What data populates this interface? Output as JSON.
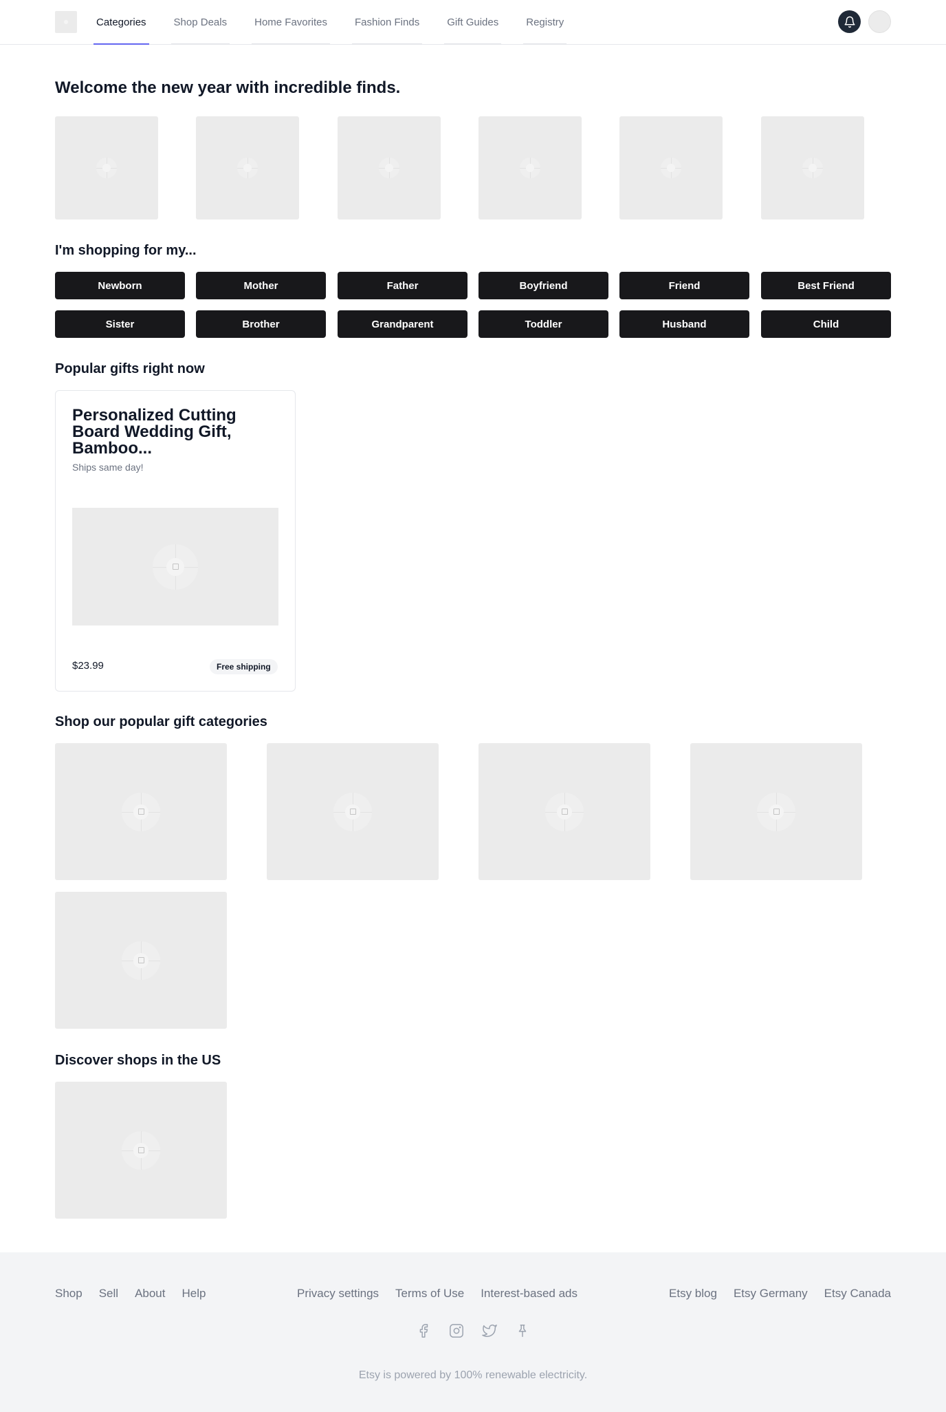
{
  "nav": {
    "tabs": [
      {
        "label": "Categories"
      },
      {
        "label": "Shop Deals"
      },
      {
        "label": "Home Favorites"
      },
      {
        "label": "Fashion Finds"
      },
      {
        "label": "Gift Guides"
      },
      {
        "label": "Registry"
      }
    ],
    "active_tab": "Categories",
    "accent_color": "#6366f1"
  },
  "icons": {
    "notifications": "bell-icon",
    "profile": "avatar"
  },
  "hero": {
    "title": "Welcome the new year with incredible finds."
  },
  "shopping_for": {
    "title": "I'm shopping for my...",
    "options": [
      "Newborn",
      "Mother",
      "Father",
      "Boyfriend",
      "Friend",
      "Best Friend",
      "Sister",
      "Brother",
      "Grandparent",
      "Toddler",
      "Husband",
      "Child"
    ]
  },
  "popular_gifts": {
    "title": "Popular gifts right now",
    "items": [
      {
        "title": "Personalized Cutting Board Wedding Gift, Bamboo...",
        "subtitle": "Ships same day!",
        "price": "$23.99",
        "badge": "Free shipping"
      }
    ]
  },
  "gift_categories": {
    "title": "Shop our popular gift categories"
  },
  "discover_shops": {
    "title": "Discover shops in the US"
  },
  "footer": {
    "left_links": [
      "Shop",
      "Sell",
      "About",
      "Help"
    ],
    "middle_links": [
      "Privacy settings",
      "Terms of Use",
      "Interest-based ads"
    ],
    "right_links": [
      "Etsy blog",
      "Etsy Germany",
      "Etsy Canada"
    ],
    "social_icons": [
      "facebook-icon",
      "instagram-icon",
      "twitter-icon",
      "pinterest-icon"
    ],
    "tagline": "Etsy is powered by 100% renewable electricity."
  }
}
